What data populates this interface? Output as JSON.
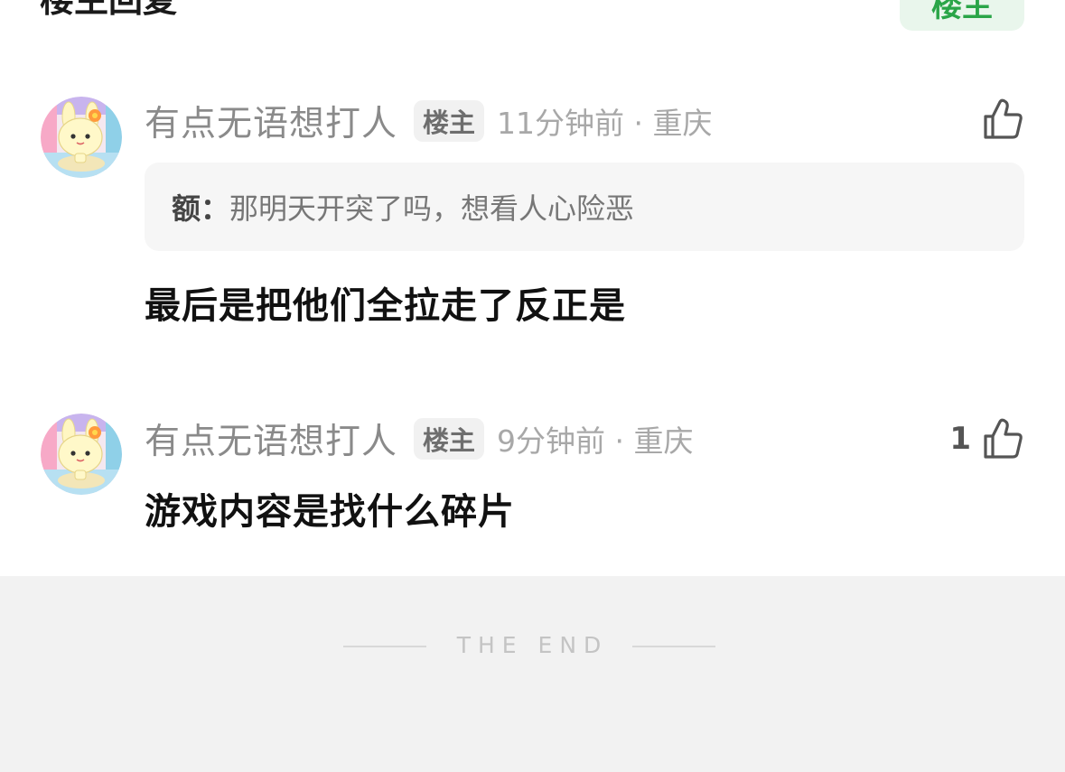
{
  "header": {
    "title": "楼主回复",
    "filter_label": "楼主"
  },
  "comments": [
    {
      "username": "有点无语想打人",
      "badge": "楼主",
      "time_location": "11分钟前 · 重庆",
      "like_count": "",
      "quote": {
        "label": "额：",
        "text": "那明天开突了吗，想看人心险恶"
      },
      "content": "最后是把他们全拉走了反正是"
    },
    {
      "username": "有点无语想打人",
      "badge": "楼主",
      "time_location": "9分钟前 · 重庆",
      "like_count": "1",
      "content": "游戏内容是找什么碎片"
    }
  ],
  "footer": {
    "end_text": "THE END"
  },
  "icons": {
    "like": "thumbs-up-icon",
    "avatar": "cartoon-bunny-avatar"
  },
  "colors": {
    "accent_green": "#2aa548",
    "filter_bg": "#e9f6ec",
    "footer_bg": "#f2f2f2"
  }
}
